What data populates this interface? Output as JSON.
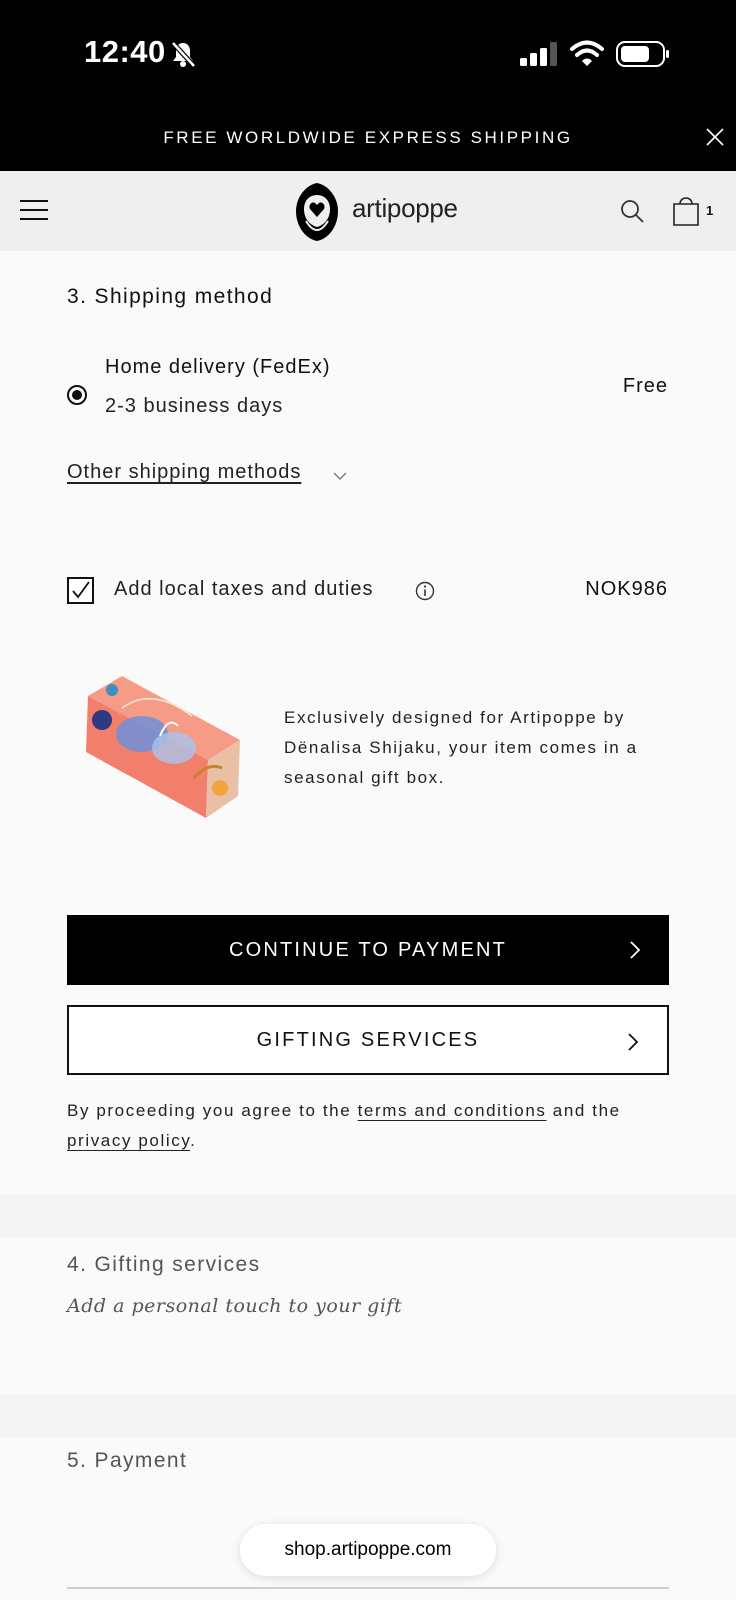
{
  "status_bar": {
    "time": "12:40"
  },
  "promo": {
    "text": "FREE WORLDWIDE EXPRESS SHIPPING"
  },
  "header": {
    "logo_text": "artipoppe",
    "cart_count": "1"
  },
  "shipping": {
    "title": "3. Shipping method",
    "option_name": "Home delivery (FedEx)",
    "option_time": "2-3 business days",
    "option_price": "Free",
    "other_methods": "Other shipping methods",
    "tax_label": "Add local taxes and duties",
    "tax_amount": "NOK986",
    "tax_checked": true,
    "gift_box_text": "Exclusively designed for Artipoppe by Dënalisa Shijaku, your item comes in a seasonal gift box.",
    "continue_label": "CONTINUE TO PAYMENT",
    "gifting_label": "GIFTING SERVICES",
    "legal_prefix": "By proceeding you agree to the ",
    "legal_terms": "terms and conditions",
    "legal_mid": " and the ",
    "legal_privacy": "privacy policy",
    "legal_suffix": "."
  },
  "gifting": {
    "title": "4. Gifting services",
    "subtitle": "Add a personal touch to your gift"
  },
  "payment": {
    "title": "5. Payment"
  },
  "browser": {
    "url": "shop.artipoppe.com"
  },
  "icons": {
    "promo_close": "close-icon",
    "menu": "menu-icon",
    "search": "search-icon",
    "cart": "shopping-bag-icon",
    "info": "info-icon",
    "chevron": "chevron-right-icon"
  },
  "colors": {
    "accent": "#000000",
    "background": "#fafafa",
    "header_bg": "#efefef"
  }
}
